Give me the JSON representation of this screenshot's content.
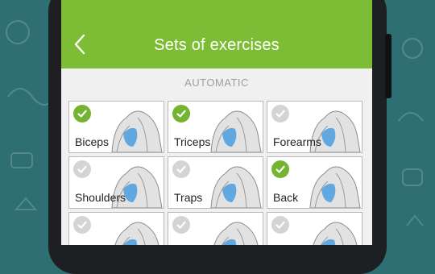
{
  "header": {
    "title": "Sets of exercises"
  },
  "section": {
    "label": "AUTOMATIC"
  },
  "colors": {
    "accent": "#7cbd35",
    "check_on": "#74b431",
    "check_off": "#d4d4d4",
    "muscle": "#4a9ee0"
  },
  "exercises": [
    {
      "label": "Biceps",
      "checked": true,
      "icon": "biceps-figure"
    },
    {
      "label": "Triceps",
      "checked": true,
      "icon": "triceps-figure"
    },
    {
      "label": "Forearms",
      "checked": false,
      "icon": "forearms-figure"
    },
    {
      "label": "Shoulders",
      "checked": false,
      "icon": "shoulders-figure"
    },
    {
      "label": "Traps",
      "checked": false,
      "icon": "traps-figure"
    },
    {
      "label": "Back",
      "checked": true,
      "icon": "back-figure"
    },
    {
      "label": "",
      "checked": false,
      "icon": "chest-figure"
    },
    {
      "label": "",
      "checked": false,
      "icon": "abs-figure"
    },
    {
      "label": "",
      "checked": false,
      "icon": "legs-figure"
    }
  ]
}
